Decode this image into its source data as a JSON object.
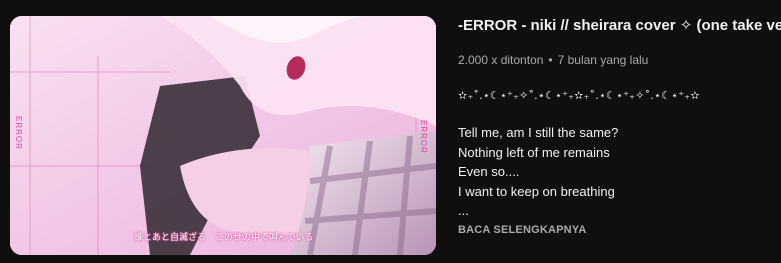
{
  "video": {
    "title": "-ERROR - niki // sheirara cover ✧ (one take ver.)",
    "views": "2.000 x ditonton",
    "separator": "•",
    "age": "7 bulan yang lalu"
  },
  "thumbnail": {
    "side_label_left": "ERROR",
    "side_label_right": "ERROR",
    "subtitle": "誰とあと自滅ざる　このせの中で叫んでいる"
  },
  "description": {
    "decoration": "✫₊˚.⋆☾⋆⁺₊✧˚.⋆☾⋆⁺₊✫₊˚.⋆☾⋆⁺₊✧˚.⋆☾⋆⁺₊✫",
    "lines": [
      "Tell me, am I still the same?",
      "Nothing left of me remains",
      "Even so....",
      "I want to keep on breathing",
      "..."
    ],
    "read_more": "BACA SELENGKAPNYA"
  },
  "colors": {
    "background": "#0f0f0f",
    "title": "#f1f1f1",
    "meta": "#aaaaaa",
    "thumb_accent": "#e0479e"
  }
}
